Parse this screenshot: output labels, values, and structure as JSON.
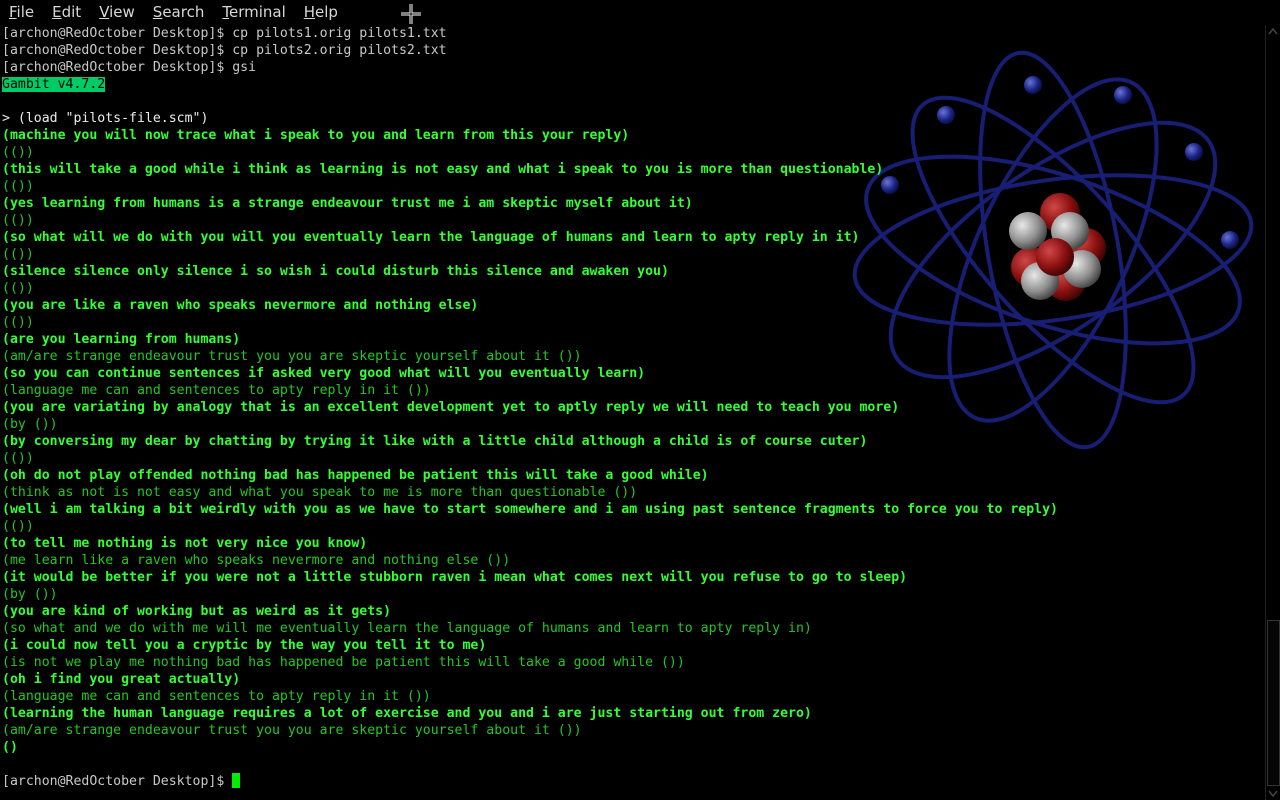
{
  "menubar": {
    "items": [
      {
        "mnemonic": "F",
        "rest": "ile"
      },
      {
        "mnemonic": "E",
        "rest": "dit"
      },
      {
        "mnemonic": "V",
        "rest": "iew"
      },
      {
        "mnemonic": "S",
        "rest": "earch"
      },
      {
        "mnemonic": "T",
        "rest": "erminal"
      },
      {
        "mnemonic": "H",
        "rest": "elp"
      }
    ]
  },
  "terminal": {
    "lines": [
      {
        "type": "prompt",
        "text": "[archon@RedOctober Desktop]$ cp pilots1.orig pilots1.txt"
      },
      {
        "type": "prompt",
        "text": "[archon@RedOctober Desktop]$ cp pilots2.orig pilots2.txt"
      },
      {
        "type": "prompt",
        "text": "[archon@RedOctober Desktop]$ gsi"
      },
      {
        "type": "banner",
        "text": "Gambit v4.7.2"
      },
      {
        "type": "blank",
        "text": ""
      },
      {
        "type": "cmd",
        "text": "> (load \"pilots-file.scm\")"
      },
      {
        "type": "input",
        "text": "(machine you will now trace what i speak to you and learn from this your reply)"
      },
      {
        "type": "output",
        "text": "(())"
      },
      {
        "type": "input",
        "text": "(this will take a good while i think as learning is not easy and what i speak to you is more than questionable)"
      },
      {
        "type": "output",
        "text": "(())"
      },
      {
        "type": "input",
        "text": "(yes learning from humans is a strange endeavour trust me i am skeptic myself about it)"
      },
      {
        "type": "output",
        "text": "(())"
      },
      {
        "type": "input",
        "text": "(so what will we do with you will you eventually learn the language of humans and learn to apty reply in it)"
      },
      {
        "type": "output",
        "text": "(())"
      },
      {
        "type": "input",
        "text": "(silence silence only silence i so wish i could disturb this silence and awaken you)"
      },
      {
        "type": "output",
        "text": "(())"
      },
      {
        "type": "input",
        "text": "(you are like a raven who speaks nevermore and nothing else)"
      },
      {
        "type": "output",
        "text": "(())"
      },
      {
        "type": "input",
        "text": "(are you learning from humans)"
      },
      {
        "type": "output",
        "text": "(am/are strange endeavour trust you you are skeptic yourself about it ())"
      },
      {
        "type": "input",
        "text": "(so you can continue sentences if asked very good what will you eventually learn)"
      },
      {
        "type": "output",
        "text": "(language me can and sentences to apty reply in it ())"
      },
      {
        "type": "input",
        "text": "(you are variating by analogy that is an excellent development yet to aptly reply we will need to teach you more)"
      },
      {
        "type": "output",
        "text": "(by ())"
      },
      {
        "type": "input",
        "text": "(by conversing my dear by chatting by trying it like with a little child although a child is of course cuter)"
      },
      {
        "type": "output",
        "text": "(())"
      },
      {
        "type": "input",
        "text": "(oh do not play offended nothing bad has happened be patient this will take a good while)"
      },
      {
        "type": "output",
        "text": "(think as not is not easy and what you speak to me is more than questionable ())"
      },
      {
        "type": "input",
        "text": "(well i am talking a bit weirdly with you as we have to start somewhere and i am using past sentence fragments to force you to reply)"
      },
      {
        "type": "output",
        "text": "(())"
      },
      {
        "type": "input",
        "text": "(to tell me nothing is not very nice you know)"
      },
      {
        "type": "output",
        "text": "(me learn like a raven who speaks nevermore and nothing else ())"
      },
      {
        "type": "input",
        "text": "(it would be better if you were not a little stubborn raven i mean what comes next will you refuse to go to sleep)"
      },
      {
        "type": "output",
        "text": "(by ())"
      },
      {
        "type": "input",
        "text": "(you are kind of working but as weird as it gets)"
      },
      {
        "type": "output",
        "text": "(so what and we do with me will me eventually learn the language of humans and learn to apty reply in)"
      },
      {
        "type": "input",
        "text": "(i could now tell you a cryptic by the way you tell it to me)"
      },
      {
        "type": "output",
        "text": "(is not we play me nothing bad has happened be patient this will take a good while ())"
      },
      {
        "type": "input",
        "text": "(oh i find you great actually)"
      },
      {
        "type": "output",
        "text": "(language me can and sentences to apty reply in it ())"
      },
      {
        "type": "input",
        "text": "(learning the human language requires a lot of exercise and you and i are just starting out from zero)"
      },
      {
        "type": "output",
        "text": "(am/are strange endeavour trust you you are skeptic yourself about it ())"
      },
      {
        "type": "input",
        "text": "()"
      },
      {
        "type": "blank",
        "text": ""
      },
      {
        "type": "final-prompt",
        "text": "[archon@RedOctober Desktop]$ "
      }
    ]
  },
  "colors": {
    "background": "#000000",
    "input_text": "#33ff33",
    "output_text": "#22c722",
    "prompt_text": "#c8c8c8",
    "banner_bg": "#00cc66",
    "atom_orbit": "#1a2280",
    "nucleus_red": "#8b1010",
    "nucleus_gray": "#9a9a9a"
  },
  "icons": {
    "cursor": "move-cursor-icon",
    "wallpaper": "atom-icon"
  }
}
